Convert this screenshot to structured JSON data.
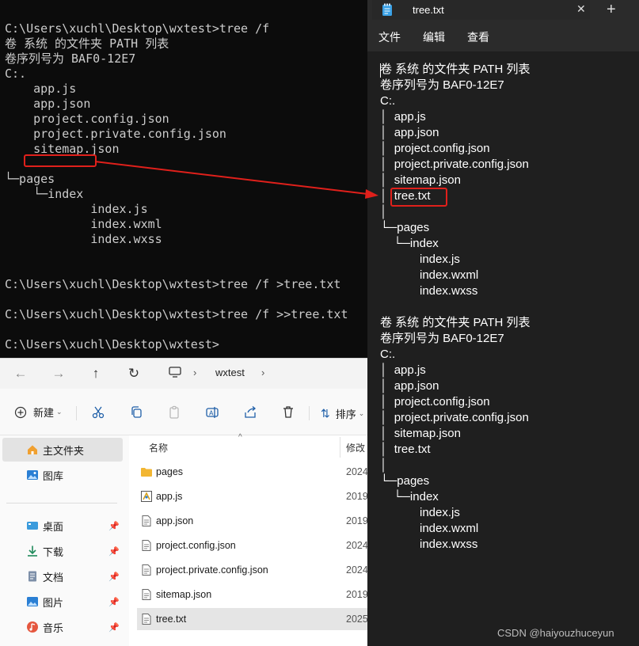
{
  "terminal": {
    "lines": [
      "C:\\Users\\xuchl\\Desktop\\wxtest>tree /f",
      "卷 系统 的文件夹 PATH 列表",
      "卷序列号为 BAF0-12E7",
      "C:.",
      "    app.js",
      "    app.json",
      "    project.config.json",
      "    project.private.config.json",
      "    sitemap.json",
      "",
      "└─pages",
      "    └─index",
      "            index.js",
      "            index.wxml",
      "            index.wxss",
      "",
      "",
      "C:\\Users\\xuchl\\Desktop\\wxtest>tree /f >tree.txt",
      "",
      "C:\\Users\\xuchl\\Desktop\\wxtest>tree /f >>tree.txt",
      "",
      "C:\\Users\\xuchl\\Desktop\\wxtest>"
    ]
  },
  "explorer": {
    "breadcrumb": [
      "wxtest"
    ],
    "toolbar": {
      "new_label": "新建",
      "sort_label": "排序"
    },
    "sidebar": [
      {
        "label": "主文件夹",
        "selected": true
      },
      {
        "label": "图库",
        "selected": false
      },
      {
        "label": "桌面",
        "selected": false
      },
      {
        "label": "下载",
        "selected": false
      },
      {
        "label": "文档",
        "selected": false
      },
      {
        "label": "图片",
        "selected": false
      },
      {
        "label": "音乐",
        "selected": false
      }
    ],
    "columns": {
      "name": "名称",
      "modified": "修改"
    },
    "files": [
      {
        "name": "pages",
        "date": "2024",
        "type": "folder",
        "selected": false
      },
      {
        "name": "app.js",
        "date": "2019",
        "type": "js",
        "selected": false
      },
      {
        "name": "app.json",
        "date": "2019",
        "type": "doc",
        "selected": false
      },
      {
        "name": "project.config.json",
        "date": "2024",
        "type": "doc",
        "selected": false
      },
      {
        "name": "project.private.config.json",
        "date": "2024",
        "type": "doc",
        "selected": false
      },
      {
        "name": "sitemap.json",
        "date": "2019",
        "type": "doc",
        "selected": false
      },
      {
        "name": "tree.txt",
        "date": "2025",
        "type": "doc",
        "selected": true
      }
    ]
  },
  "notepad": {
    "tab_title": "tree.txt",
    "close_glyph": "✕",
    "add_glyph": "+",
    "menus": [
      "文件",
      "编辑",
      "查看"
    ],
    "lines": [
      "卷 系统 的文件夹 PATH 列表",
      "卷序列号为 BAF0-12E7",
      "C:.",
      "│  app.js",
      "│  app.json",
      "│  project.config.json",
      "│  project.private.config.json",
      "│  sitemap.json",
      "│  tree.txt",
      "│",
      "└─pages",
      "    └─index",
      "            index.js",
      "            index.wxml",
      "            index.wxss",
      "",
      "卷 系统 的文件夹 PATH 列表",
      "卷序列号为 BAF0-12E7",
      "C:.",
      "│  app.js",
      "│  app.json",
      "│  project.config.json",
      "│  project.private.config.json",
      "│  sitemap.json",
      "│  tree.txt",
      "│",
      "└─pages",
      "    └─index",
      "            index.js",
      "            index.wxml",
      "            index.wxss"
    ]
  },
  "watermark": "CSDN @haiyouzhuceyun",
  "colors": {
    "highlight": "#e0201b",
    "terminal_bg": "#0c0c0c",
    "notepad_bg": "#1f1f1f"
  }
}
